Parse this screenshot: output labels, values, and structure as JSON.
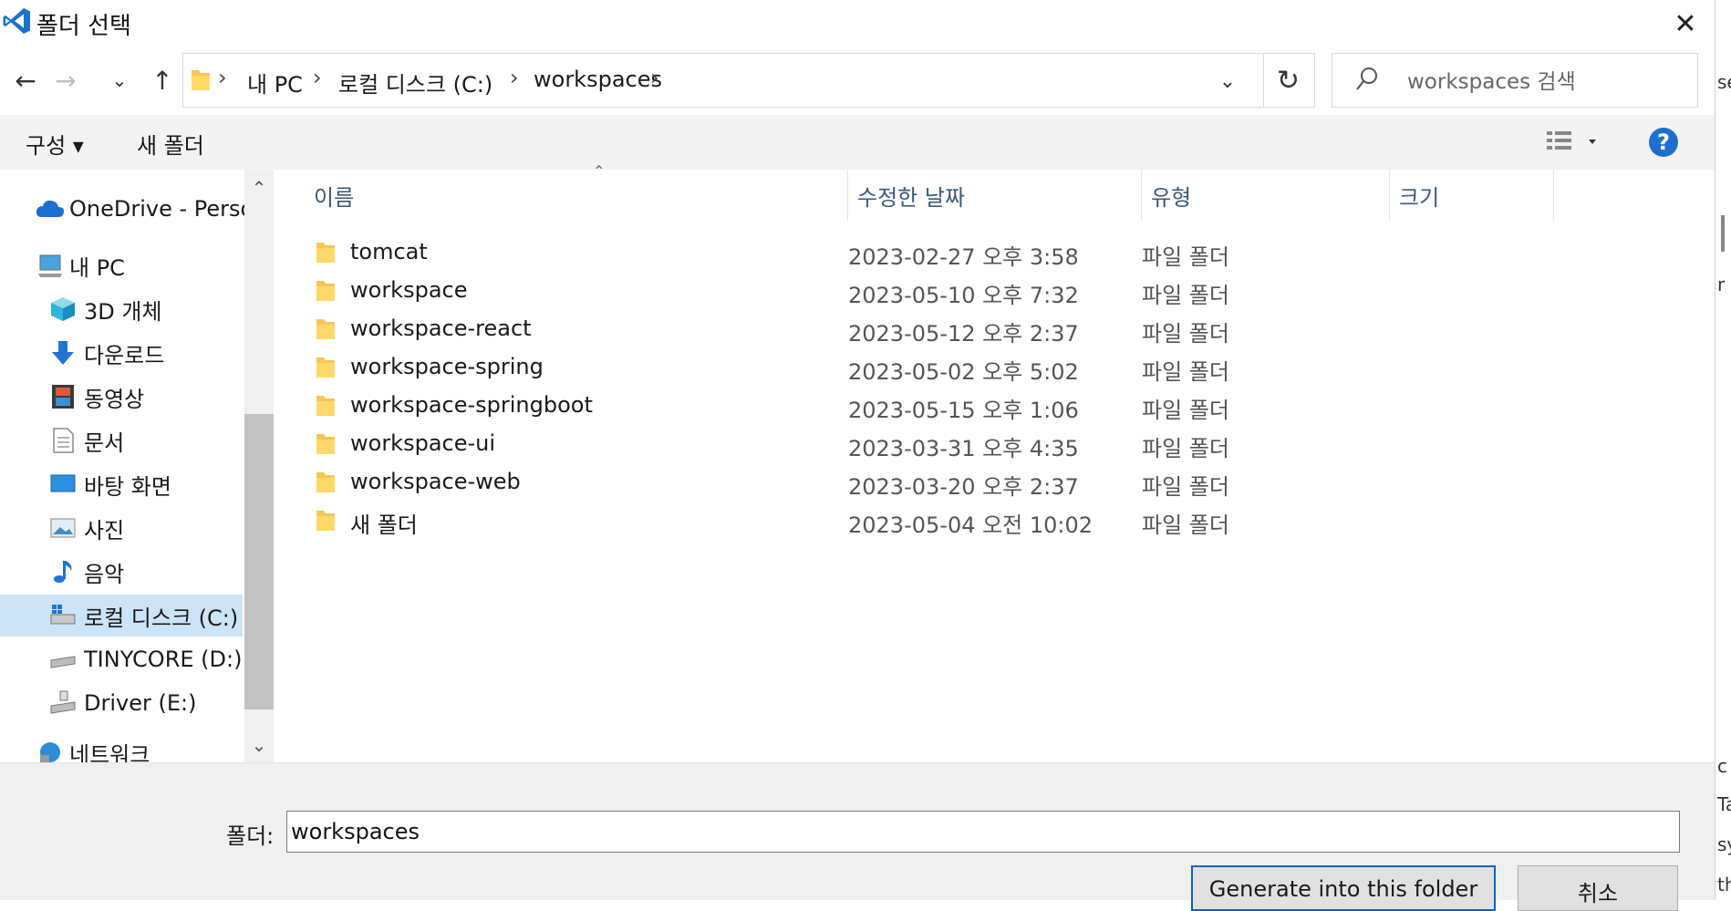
{
  "window": {
    "title": "폴더 선택",
    "accent": "#0b63c5"
  },
  "address": {
    "crumbs": [
      "내 PC",
      "로컬 디스크 (C:)",
      "workspaces"
    ]
  },
  "search": {
    "placeholder": "workspaces 검색"
  },
  "toolbar": {
    "organize_label": "구성 ▾",
    "new_folder_label": "새 폴더",
    "help_label": "?"
  },
  "nav": {
    "items": [
      {
        "label": "OneDrive - Persor",
        "icon": "cloud-icon"
      },
      {
        "label": "내 PC",
        "icon": "computer-icon"
      },
      {
        "label": "3D 개체",
        "icon": "cube-icon"
      },
      {
        "label": "다운로드",
        "icon": "download-icon"
      },
      {
        "label": "동영상",
        "icon": "video-icon"
      },
      {
        "label": "문서",
        "icon": "document-icon"
      },
      {
        "label": "바탕 화면",
        "icon": "desktop-icon"
      },
      {
        "label": "사진",
        "icon": "picture-icon"
      },
      {
        "label": "음악",
        "icon": "music-icon"
      },
      {
        "label": "로컬 디스크 (C:)",
        "icon": "drive-icon",
        "selected": true
      },
      {
        "label": "TINYCORE (D:)",
        "icon": "drive-icon"
      },
      {
        "label": "Driver (E:)",
        "icon": "usb-drive-icon"
      },
      {
        "label": "네트워크",
        "icon": "network-icon"
      }
    ]
  },
  "columns": {
    "name": "이름",
    "date": "수정한 날짜",
    "type": "유형",
    "size": "크기"
  },
  "files": [
    {
      "name": "tomcat",
      "date": "2023-02-27 오후 3:58",
      "type": "파일 폴더"
    },
    {
      "name": "workspace",
      "date": "2023-05-10 오후 7:32",
      "type": "파일 폴더"
    },
    {
      "name": "workspace-react",
      "date": "2023-05-12 오후 2:37",
      "type": "파일 폴더"
    },
    {
      "name": "workspace-spring",
      "date": "2023-05-02 오후 5:02",
      "type": "파일 폴더"
    },
    {
      "name": "workspace-springboot",
      "date": "2023-05-15 오후 1:06",
      "type": "파일 폴더"
    },
    {
      "name": "workspace-ui",
      "date": "2023-03-31 오후 4:35",
      "type": "파일 폴더"
    },
    {
      "name": "workspace-web",
      "date": "2023-03-20 오후 2:37",
      "type": "파일 폴더"
    },
    {
      "name": "새 폴더",
      "date": "2023-05-04 오전 10:02",
      "type": "파일 폴더"
    }
  ],
  "footer": {
    "folder_label": "폴더:",
    "folder_value": "workspaces",
    "primary_button": "Generate into this folder",
    "cancel_button": "취소"
  },
  "edge": {
    "chars": [
      "se",
      "r",
      "c",
      "Ta",
      "sy",
      "th"
    ]
  }
}
